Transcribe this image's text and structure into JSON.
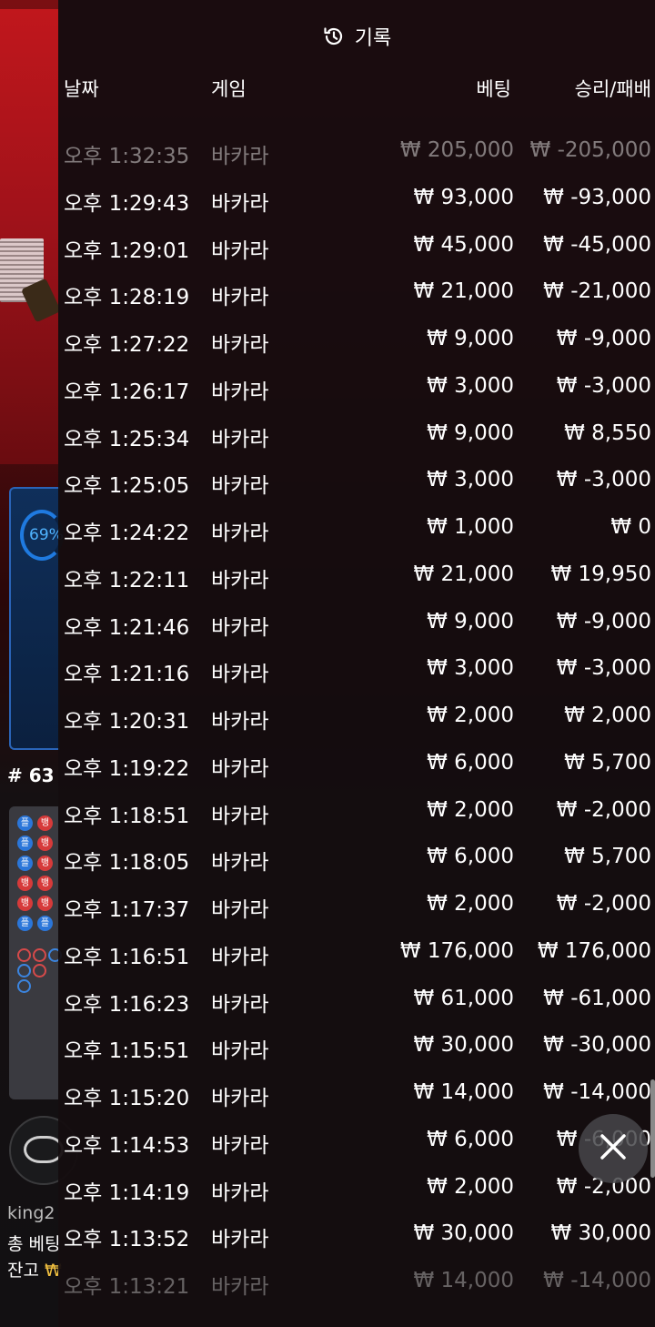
{
  "header": {
    "title": "기록",
    "icon": "history-icon"
  },
  "columns": {
    "date": "날짜",
    "game": "게임",
    "bet": "베팅",
    "result": "승리/패배"
  },
  "rows": [
    {
      "date": "오후 1:32:35",
      "game": "바카라",
      "bet": "₩ 205,000",
      "result": "₩ -205,000"
    },
    {
      "date": "오후 1:29:43",
      "game": "바카라",
      "bet": "₩ 93,000",
      "result": "₩ -93,000"
    },
    {
      "date": "오후 1:29:01",
      "game": "바카라",
      "bet": "₩ 45,000",
      "result": "₩ -45,000"
    },
    {
      "date": "오후 1:28:19",
      "game": "바카라",
      "bet": "₩ 21,000",
      "result": "₩ -21,000"
    },
    {
      "date": "오후 1:27:22",
      "game": "바카라",
      "bet": "₩ 9,000",
      "result": "₩ -9,000"
    },
    {
      "date": "오후 1:26:17",
      "game": "바카라",
      "bet": "₩ 3,000",
      "result": "₩ -3,000"
    },
    {
      "date": "오후 1:25:34",
      "game": "바카라",
      "bet": "₩ 9,000",
      "result": "₩ 8,550"
    },
    {
      "date": "오후 1:25:05",
      "game": "바카라",
      "bet": "₩ 3,000",
      "result": "₩ -3,000"
    },
    {
      "date": "오후 1:24:22",
      "game": "바카라",
      "bet": "₩ 1,000",
      "result": "₩ 0"
    },
    {
      "date": "오후 1:22:11",
      "game": "바카라",
      "bet": "₩ 21,000",
      "result": "₩ 19,950"
    },
    {
      "date": "오후 1:21:46",
      "game": "바카라",
      "bet": "₩ 9,000",
      "result": "₩ -9,000"
    },
    {
      "date": "오후 1:21:16",
      "game": "바카라",
      "bet": "₩ 3,000",
      "result": "₩ -3,000"
    },
    {
      "date": "오후 1:20:31",
      "game": "바카라",
      "bet": "₩ 2,000",
      "result": "₩ 2,000"
    },
    {
      "date": "오후 1:19:22",
      "game": "바카라",
      "bet": "₩ 6,000",
      "result": "₩ 5,700"
    },
    {
      "date": "오후 1:18:51",
      "game": "바카라",
      "bet": "₩ 2,000",
      "result": "₩ -2,000"
    },
    {
      "date": "오후 1:18:05",
      "game": "바카라",
      "bet": "₩ 6,000",
      "result": "₩ 5,700"
    },
    {
      "date": "오후 1:17:37",
      "game": "바카라",
      "bet": "₩ 2,000",
      "result": "₩ -2,000"
    },
    {
      "date": "오후 1:16:51",
      "game": "바카라",
      "bet": "₩ 176,000",
      "result": "₩ 176,000"
    },
    {
      "date": "오후 1:16:23",
      "game": "바카라",
      "bet": "₩ 61,000",
      "result": "₩ -61,000"
    },
    {
      "date": "오후 1:15:51",
      "game": "바카라",
      "bet": "₩ 30,000",
      "result": "₩ -30,000"
    },
    {
      "date": "오후 1:15:20",
      "game": "바카라",
      "bet": "₩ 14,000",
      "result": "₩ -14,000"
    },
    {
      "date": "오후 1:14:53",
      "game": "바카라",
      "bet": "₩ 6,000",
      "result": "₩ -6,000"
    },
    {
      "date": "오후 1:14:19",
      "game": "바카라",
      "bet": "₩ 2,000",
      "result": "₩ -2,000"
    },
    {
      "date": "오후 1:13:52",
      "game": "바카라",
      "bet": "₩ 30,000",
      "result": "₩ 30,000"
    },
    {
      "date": "오후 1:13:21",
      "game": "바카라",
      "bet": "₩ 14,000",
      "result": "₩ -14,000"
    }
  ],
  "background": {
    "percent": "69%",
    "round": "# 63",
    "user": "king2",
    "total_bet_label": "총 베팅",
    "balance_label": "잔고",
    "balance_symbol": "₩"
  },
  "close_button": {
    "icon": "close-icon"
  },
  "colors": {
    "panel": "#140d0f",
    "text": "#ffffff",
    "accent_blue": "#1f7ae0"
  }
}
